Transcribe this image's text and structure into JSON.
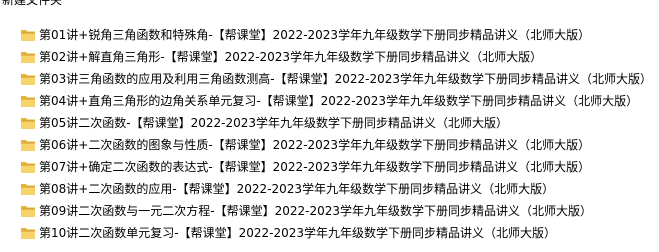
{
  "header": {
    "label": "新建文件夹"
  },
  "items": [
    {
      "name": "第01讲+锐角三角函数和特殊角-【帮课堂】2022-2023学年九年级数学下册同步精品讲义（北师大版）",
      "icon": "folder-icon"
    },
    {
      "name": "第02讲+解直角三角形-【帮课堂】2022-2023学年九年级数学下册同步精品讲义（北师大版）",
      "icon": "folder-icon"
    },
    {
      "name": "第03讲三角函数的应用及利用三角函数测高-【帮课堂】2022-2023学年九年级数学下册同步精品讲义（北师大版）",
      "icon": "folder-icon"
    },
    {
      "name": "第04讲+直角三角形的边角关系单元复习-【帮课堂】2022-2023学年九年级数学下册同步精品讲义（北师大版）",
      "icon": "folder-icon"
    },
    {
      "name": "第05讲二次函数-【帮课堂】2022-2023学年九年级数学下册同步精品讲义（北师大版）",
      "icon": "folder-icon"
    },
    {
      "name": "第06讲+二次函数的图象与性质-【帮课堂】2022-2023学年九年级数学下册同步精品讲义（北师大版）",
      "icon": "folder-icon"
    },
    {
      "name": "第07讲+确定二次函数的表达式-【帮课堂】2022-2023学年九年级数学下册同步精品讲义（北师大版）",
      "icon": "folder-icon"
    },
    {
      "name": "第08讲+二次函数的应用-【帮课堂】2022-2023学年九年级数学下册同步精品讲义（北师大版）",
      "icon": "folder-icon"
    },
    {
      "name": "第09讲二次函数与一元二次方程-【帮课堂】2022-2023学年九年级数学下册同步精品讲义（北师大版）",
      "icon": "folder-icon"
    },
    {
      "name": "第10讲二次函数单元复习-【帮课堂】2022-2023学年九年级数学下册同步精品讲义（北师大版）",
      "icon": "folder-icon"
    }
  ]
}
